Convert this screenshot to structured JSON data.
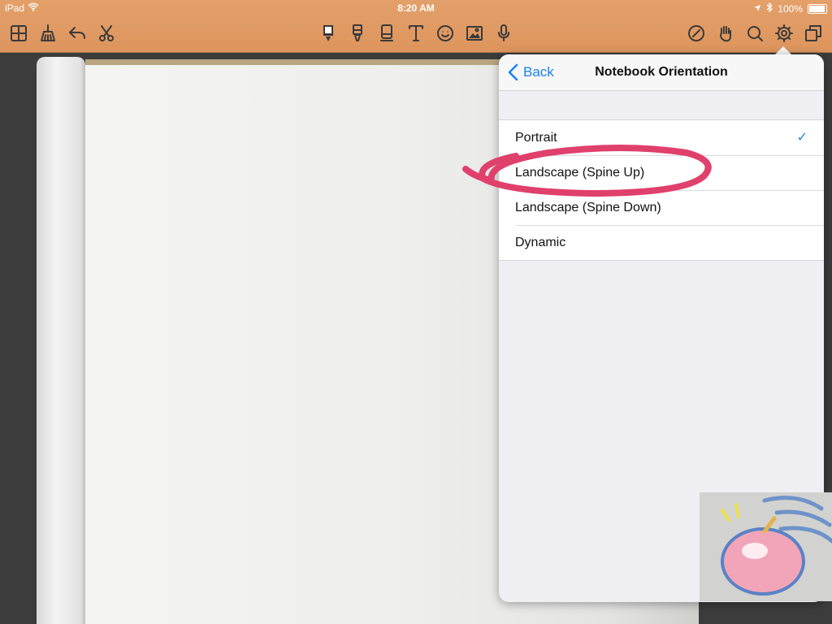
{
  "status_bar": {
    "device": "iPad",
    "time": "8:20 AM",
    "battery": "100%"
  },
  "toolbar": {
    "left_icons": [
      "grid-icon",
      "broom-icon",
      "undo-icon",
      "scissors-icon"
    ],
    "center_icons": [
      "pen-icon",
      "highlighter-icon",
      "eraser-icon",
      "text-icon",
      "emoji-icon",
      "image-icon",
      "microphone-icon"
    ],
    "right_icons": [
      "pencil-circle-icon",
      "hand-icon",
      "search-icon",
      "gear-icon",
      "copy-pages-icon"
    ]
  },
  "popover": {
    "back_label": "Back",
    "title": "Notebook Orientation",
    "options": [
      {
        "label": "Portrait",
        "checked": true
      },
      {
        "label": "Landscape (Spine Up)",
        "checked": false
      },
      {
        "label": "Landscape (Spine Down)",
        "checked": false
      },
      {
        "label": "Dynamic",
        "checked": false
      }
    ],
    "check_mark": "✓"
  },
  "colors": {
    "toolbar": "#dd955d",
    "accent": "#1a82ee",
    "annotation": "#e0406c"
  }
}
